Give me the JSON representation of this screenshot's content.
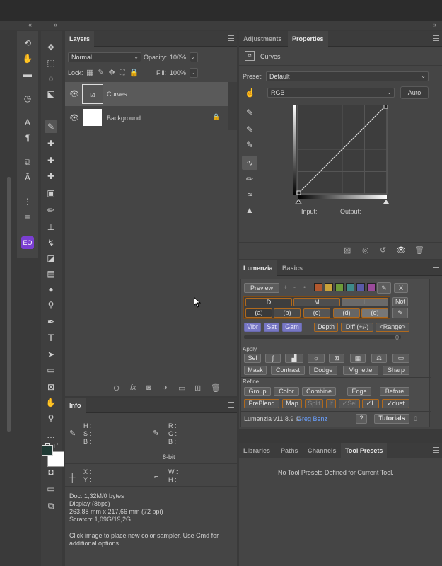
{
  "layers_panel": {
    "tab": "Layers",
    "blend_mode": "Normal",
    "opacity_label": "Opacity:",
    "opacity_value": "100%",
    "lock_label": "Lock:",
    "fill_label": "Fill:",
    "fill_value": "100%",
    "layers": [
      {
        "name": "Curves"
      },
      {
        "name": "Background"
      }
    ]
  },
  "info_panel": {
    "tab": "Info",
    "h": "H :",
    "s": "S :",
    "b": "B :",
    "r": "R :",
    "g": "G :",
    "b2": "B :",
    "bit_depth": "8-bit",
    "x": "X :",
    "y": "Y :",
    "w": "W :",
    "hh": "H :",
    "doc": "Doc: 1,32M/0 bytes",
    "display": "Display (8bpc)",
    "dims": "263,88 mm x 217,66 mm (72 ppi)",
    "scratch": "Scratch: 1,09G/19,2G",
    "hint1": "Click image to place new color sampler.  Use Cmd for",
    "hint2": "additional options."
  },
  "properties_panel": {
    "tabs": [
      "Adjustments",
      "Properties"
    ],
    "title": "Curves",
    "preset_label": "Preset:",
    "preset_value": "Default",
    "channel_value": "RGB",
    "auto_label": "Auto",
    "input_label": "Input:",
    "output_label": "Output:"
  },
  "lumenzia_panel": {
    "tabs": [
      "Lumenzia",
      "Basics"
    ],
    "preview": "Preview",
    "plus": "+",
    "minus": "-",
    "dot": "•",
    "x": "X",
    "swatches": [
      "#b2582e",
      "#c9a23a",
      "#6d9a3a",
      "#3e8a8a",
      "#5a5aa8",
      "#9a4a9a"
    ],
    "zone_row1": [
      "D",
      "M",
      "L"
    ],
    "not": "Not",
    "zone_row2": [
      "(a)",
      "(b)",
      "(c)",
      "(d)",
      "(e)"
    ],
    "mod_row": [
      "Vibr",
      "Sat",
      "Gam",
      "Depth",
      "Diff (+/-)",
      "<Range>"
    ],
    "slider_value": "0",
    "apply_label": "Apply",
    "apply_row2": [
      "Mask",
      "Contrast",
      "Dodge",
      "Vignette",
      "Sharp"
    ],
    "sel_label": "Sel",
    "refine_label": "Refine",
    "refine_row1": [
      "Group",
      "Color",
      "Combine",
      "Edge",
      "Before"
    ],
    "refine_row2": [
      "PreBlend",
      "Map",
      "Split",
      "If",
      "✓Sel",
      "✓L",
      "✓dust"
    ],
    "version": "Lumenzia v11.8.9 ©",
    "author": "Greg Benz",
    "help": "?",
    "tutorials": "Tutorials",
    "tut_count": "0"
  },
  "presets_panel": {
    "tabs": [
      "Libraries",
      "Paths",
      "Channels",
      "Tool Presets"
    ],
    "empty_text": "No Tool Presets Defined for Current Tool."
  },
  "colors": {
    "accent_orange": "#b06a1e",
    "accent_blue": "#7777c4",
    "foreground": "#1f3a34",
    "background": "#ffffff"
  }
}
